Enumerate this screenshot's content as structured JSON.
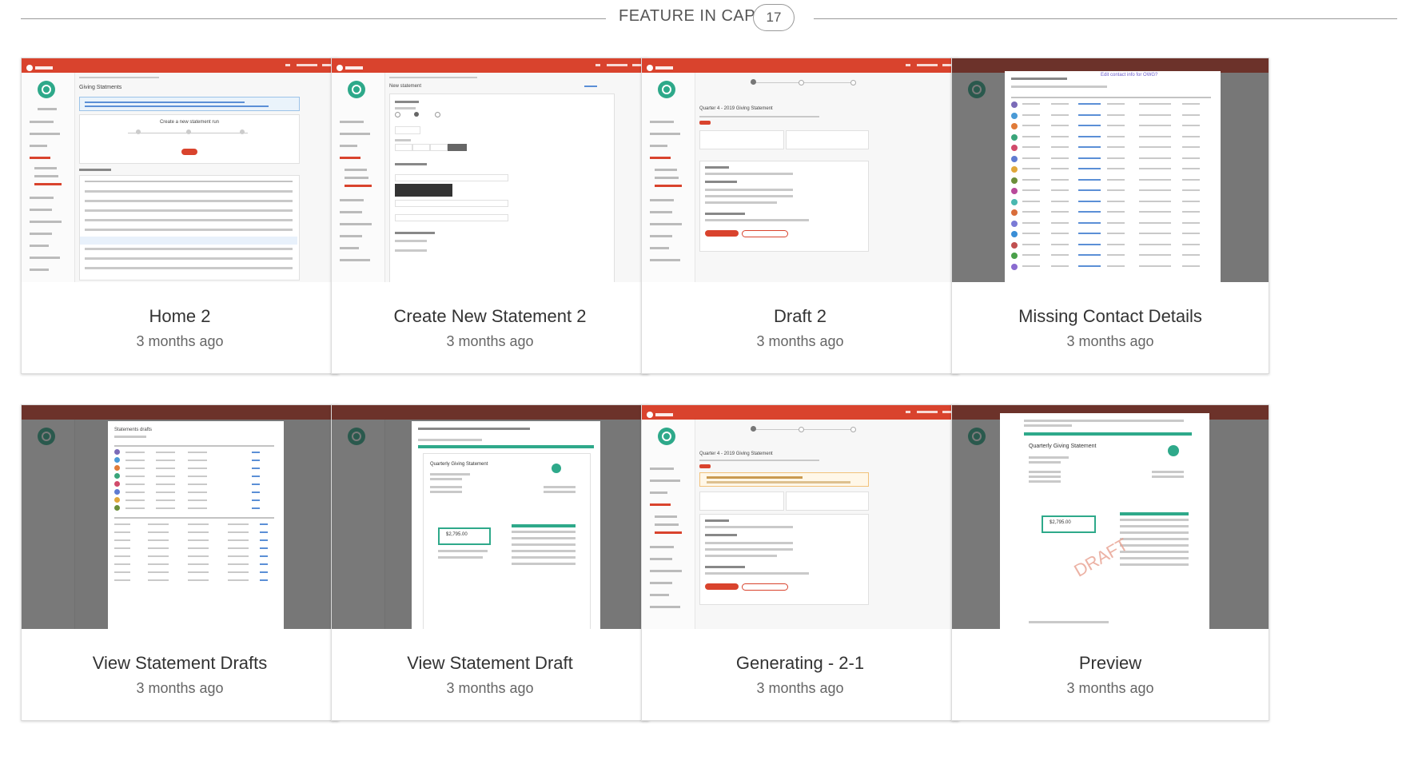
{
  "section": {
    "title": "FEATURE IN CAP",
    "count": "17"
  },
  "cards": [
    {
      "name": "Home 2",
      "time": "3 months ago"
    },
    {
      "name": "Create New Statement 2",
      "time": "3 months ago"
    },
    {
      "name": "Draft 2",
      "time": "3 months ago"
    },
    {
      "name": "Missing Contact Details",
      "time": "3 months ago"
    },
    {
      "name": "View Statement Drafts",
      "time": "3 months ago"
    },
    {
      "name": "View Statement Draft",
      "time": "3 months ago"
    },
    {
      "name": "Generating - 2-1",
      "time": "3 months ago"
    },
    {
      "name": "Preview",
      "time": "3 months ago"
    }
  ],
  "thumb_text": {
    "giving_statments": "Giving Statments",
    "create_run": "Create a new statement run",
    "new_statement": "New statement",
    "draft_title": "Quarter 4 - 2019 Giving Statement",
    "missing_link": "Edit contact info for OWG?",
    "drafts_title": "Statements drafts",
    "qgs": "Quarterly Giving Statement",
    "amount": "$2,795.00",
    "draft_watermark": "DRAFT"
  },
  "colors": {
    "brand_red": "#d9432d",
    "teal": "#2ea98a"
  }
}
